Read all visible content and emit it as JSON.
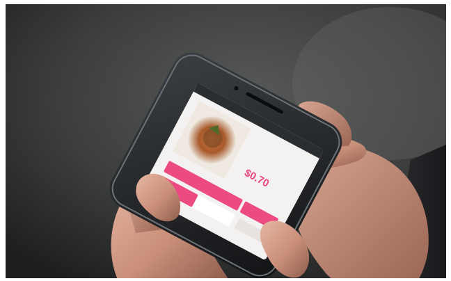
{
  "scene": {
    "description_colors": {
      "background": "#3a3b3a",
      "phone_body": "#1f2225",
      "screen": "#f4f2f1",
      "accent": "#ec4a83"
    }
  },
  "app": {
    "dish_title_lines": [
      "",
      "",
      ""
    ],
    "price": "$0.70",
    "order_button_label": "",
    "side_button_label": ""
  }
}
